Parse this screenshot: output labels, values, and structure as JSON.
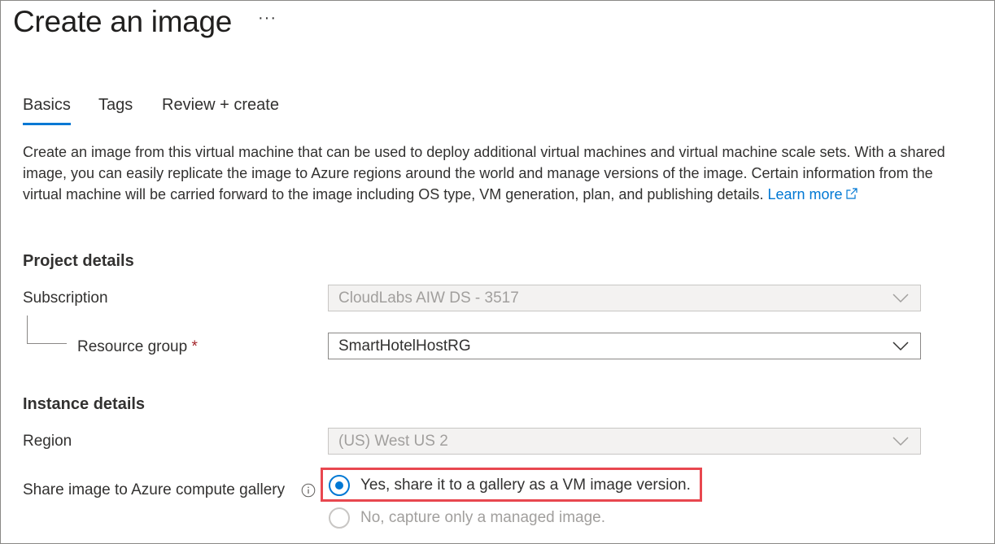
{
  "header": {
    "title": "Create an image",
    "more_label": "···"
  },
  "tabs": [
    {
      "label": "Basics",
      "active": true
    },
    {
      "label": "Tags",
      "active": false
    },
    {
      "label": "Review + create",
      "active": false
    }
  ],
  "description": {
    "text": "Create an image from this virtual machine that can be used to deploy additional virtual machines and virtual machine scale sets. With a shared image, you can easily replicate the image to Azure regions around the world and manage versions of the image. Certain information from the virtual machine will be carried forward to the image including OS type, VM generation, plan, and publishing details.",
    "link_text": "Learn more"
  },
  "project_details": {
    "heading": "Project details",
    "subscription": {
      "label": "Subscription",
      "value": "CloudLabs AIW DS - 3517",
      "disabled": true
    },
    "resource_group": {
      "label": "Resource group",
      "required_mark": "*",
      "value": "SmartHotelHostRG",
      "disabled": false
    }
  },
  "instance_details": {
    "heading": "Instance details",
    "region": {
      "label": "Region",
      "value": "(US) West US 2",
      "disabled": true
    },
    "share_gallery": {
      "label": "Share image to Azure compute gallery",
      "options": [
        {
          "label": "Yes, share it to a gallery as a VM image version.",
          "checked": true,
          "disabled": false
        },
        {
          "label": "No, capture only a managed image.",
          "checked": false,
          "disabled": true
        }
      ]
    }
  },
  "colors": {
    "accent": "#0078d4",
    "highlight": "#e8474f",
    "required": "#a4262c"
  },
  "icons": {
    "more": "ellipsis-icon",
    "external_link": "external-link-icon",
    "dropdown": "chevron-down-icon",
    "info": "info-icon"
  }
}
